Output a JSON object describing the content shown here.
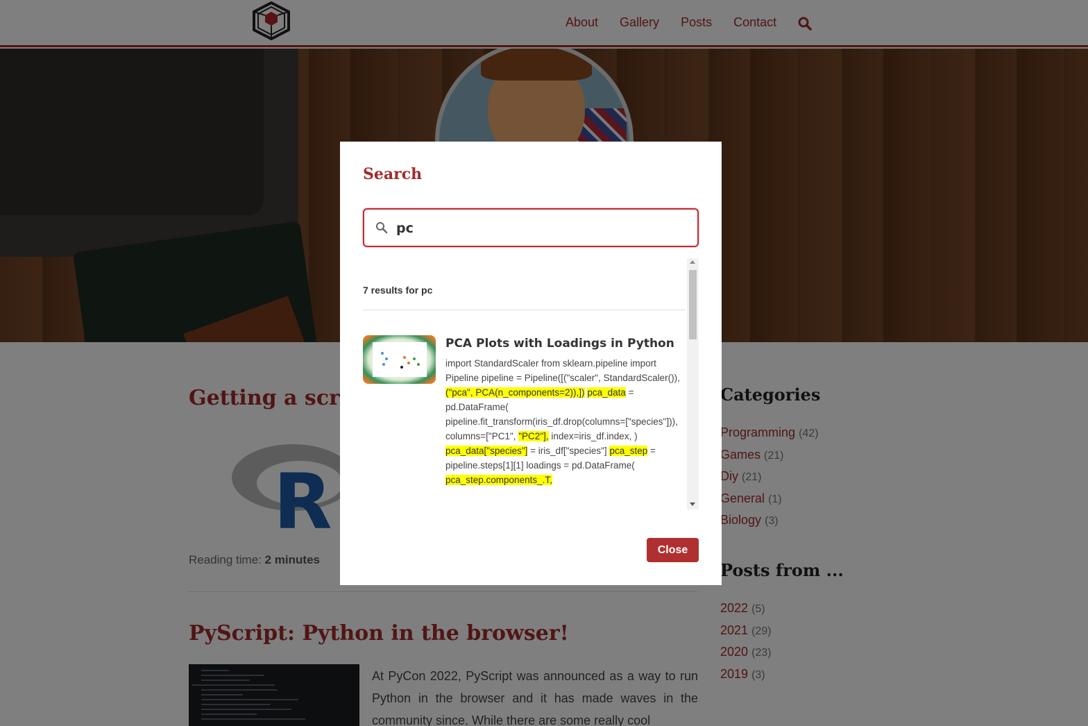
{
  "nav": {
    "links": [
      "About",
      "Gallery",
      "Posts",
      "Contact"
    ],
    "search_icon": "search-icon"
  },
  "posts": [
    {
      "title": "Getting a script",
      "reading_time_label": "Reading time:",
      "reading_time_value": "2 minutes"
    },
    {
      "title": "PyScript: Python in the browser!",
      "excerpt": "At PyCon 2022, PyScript was announced as a way to run Python in the browser and it has made waves in the community since. While there are some really cool"
    }
  ],
  "sidebar": {
    "categories_title": "Categories",
    "categories": [
      {
        "name": "Programming",
        "count": "(42)"
      },
      {
        "name": "Games",
        "count": "(21)"
      },
      {
        "name": "Diy",
        "count": "(21)"
      },
      {
        "name": "General",
        "count": "(1)"
      },
      {
        "name": "Biology",
        "count": "(3)"
      }
    ],
    "posts_from_title": "Posts from ...",
    "years": [
      {
        "name": "2022",
        "count": "(5)"
      },
      {
        "name": "2021",
        "count": "(29)"
      },
      {
        "name": "2020",
        "count": "(23)"
      },
      {
        "name": "2019",
        "count": "(3)"
      }
    ]
  },
  "modal": {
    "title": "Search",
    "query": "pc",
    "results_count": "7 results for pc",
    "result": {
      "title": "PCA Plots with Loadings in Python",
      "excerpt_parts": [
        {
          "t": "import StandardScaler from sklearn.pipeline import Pipeline pipeline = Pipeline([(\"scaler\", StandardScaler()), ",
          "h": false
        },
        {
          "t": "(\"pca\", PCA(n_components=2)),])",
          "h": true
        },
        {
          "t": " ",
          "h": false
        },
        {
          "t": "pca_data",
          "h": true
        },
        {
          "t": " = pd.DataFrame( pipeline.fit_transform(iris_df.drop(columns=[\"species\"])), columns=[\"PC1\", ",
          "h": false
        },
        {
          "t": "\"PC2\"],",
          "h": true
        },
        {
          "t": " index=iris_df.index, ) ",
          "h": false
        },
        {
          "t": "pca_data[\"species\"]",
          "h": true
        },
        {
          "t": " = iris_df[\"species\"] ",
          "h": false
        },
        {
          "t": "pca_step",
          "h": true
        },
        {
          "t": " = pipeline.steps[1][1] loadings = pd.DataFrame( ",
          "h": false
        },
        {
          "t": "pca_step.components_.T,",
          "h": true
        }
      ]
    },
    "close_label": "Close"
  },
  "colors": {
    "accent": "#a32a2a",
    "highlight": "#ffff00",
    "close_button": "#b0302f"
  }
}
